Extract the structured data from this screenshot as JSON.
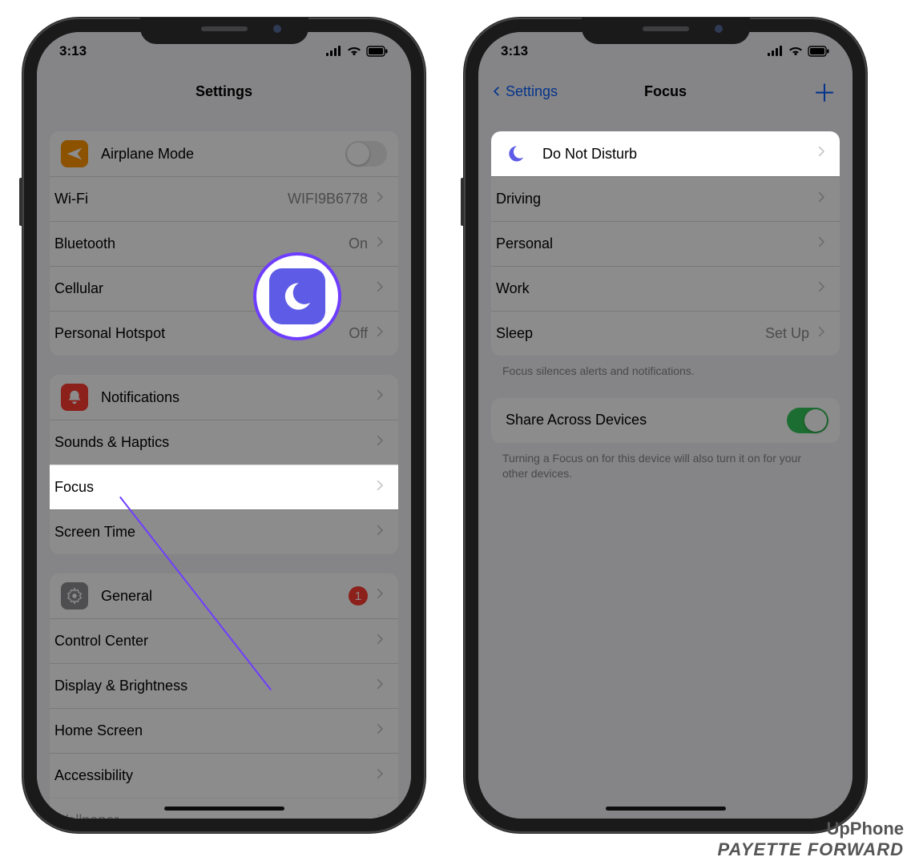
{
  "status": {
    "time": "3:13"
  },
  "leftPhone": {
    "title": "Settings",
    "group1": {
      "airplane": "Airplane Mode",
      "wifi": "Wi-Fi",
      "wifi_detail": "WIFI9B6778",
      "bluetooth": "Bluetooth",
      "bluetooth_detail": "On",
      "cellular": "Cellular",
      "hotspot": "Personal Hotspot",
      "hotspot_detail": "Off"
    },
    "group2": {
      "notifications": "Notifications",
      "sounds": "Sounds & Haptics",
      "focus": "Focus",
      "screentime": "Screen Time"
    },
    "group3": {
      "general": "General",
      "general_badge": "1",
      "controlcenter": "Control Center",
      "display": "Display & Brightness",
      "homescreen": "Home Screen",
      "accessibility": "Accessibility",
      "wallpaper": "Wallpaper"
    }
  },
  "rightPhone": {
    "back": "Settings",
    "title": "Focus",
    "items": {
      "dnd": "Do Not Disturb",
      "driving": "Driving",
      "personal": "Personal",
      "work": "Work",
      "sleep": "Sleep",
      "sleep_detail": "Set Up"
    },
    "note1": "Focus silences alerts and notifications.",
    "share": "Share Across Devices",
    "note2": "Turning a Focus on for this device will also turn it on for your other devices."
  },
  "watermark": {
    "line1": "UpPhone",
    "line2": "PAYETTE FORWARD"
  }
}
